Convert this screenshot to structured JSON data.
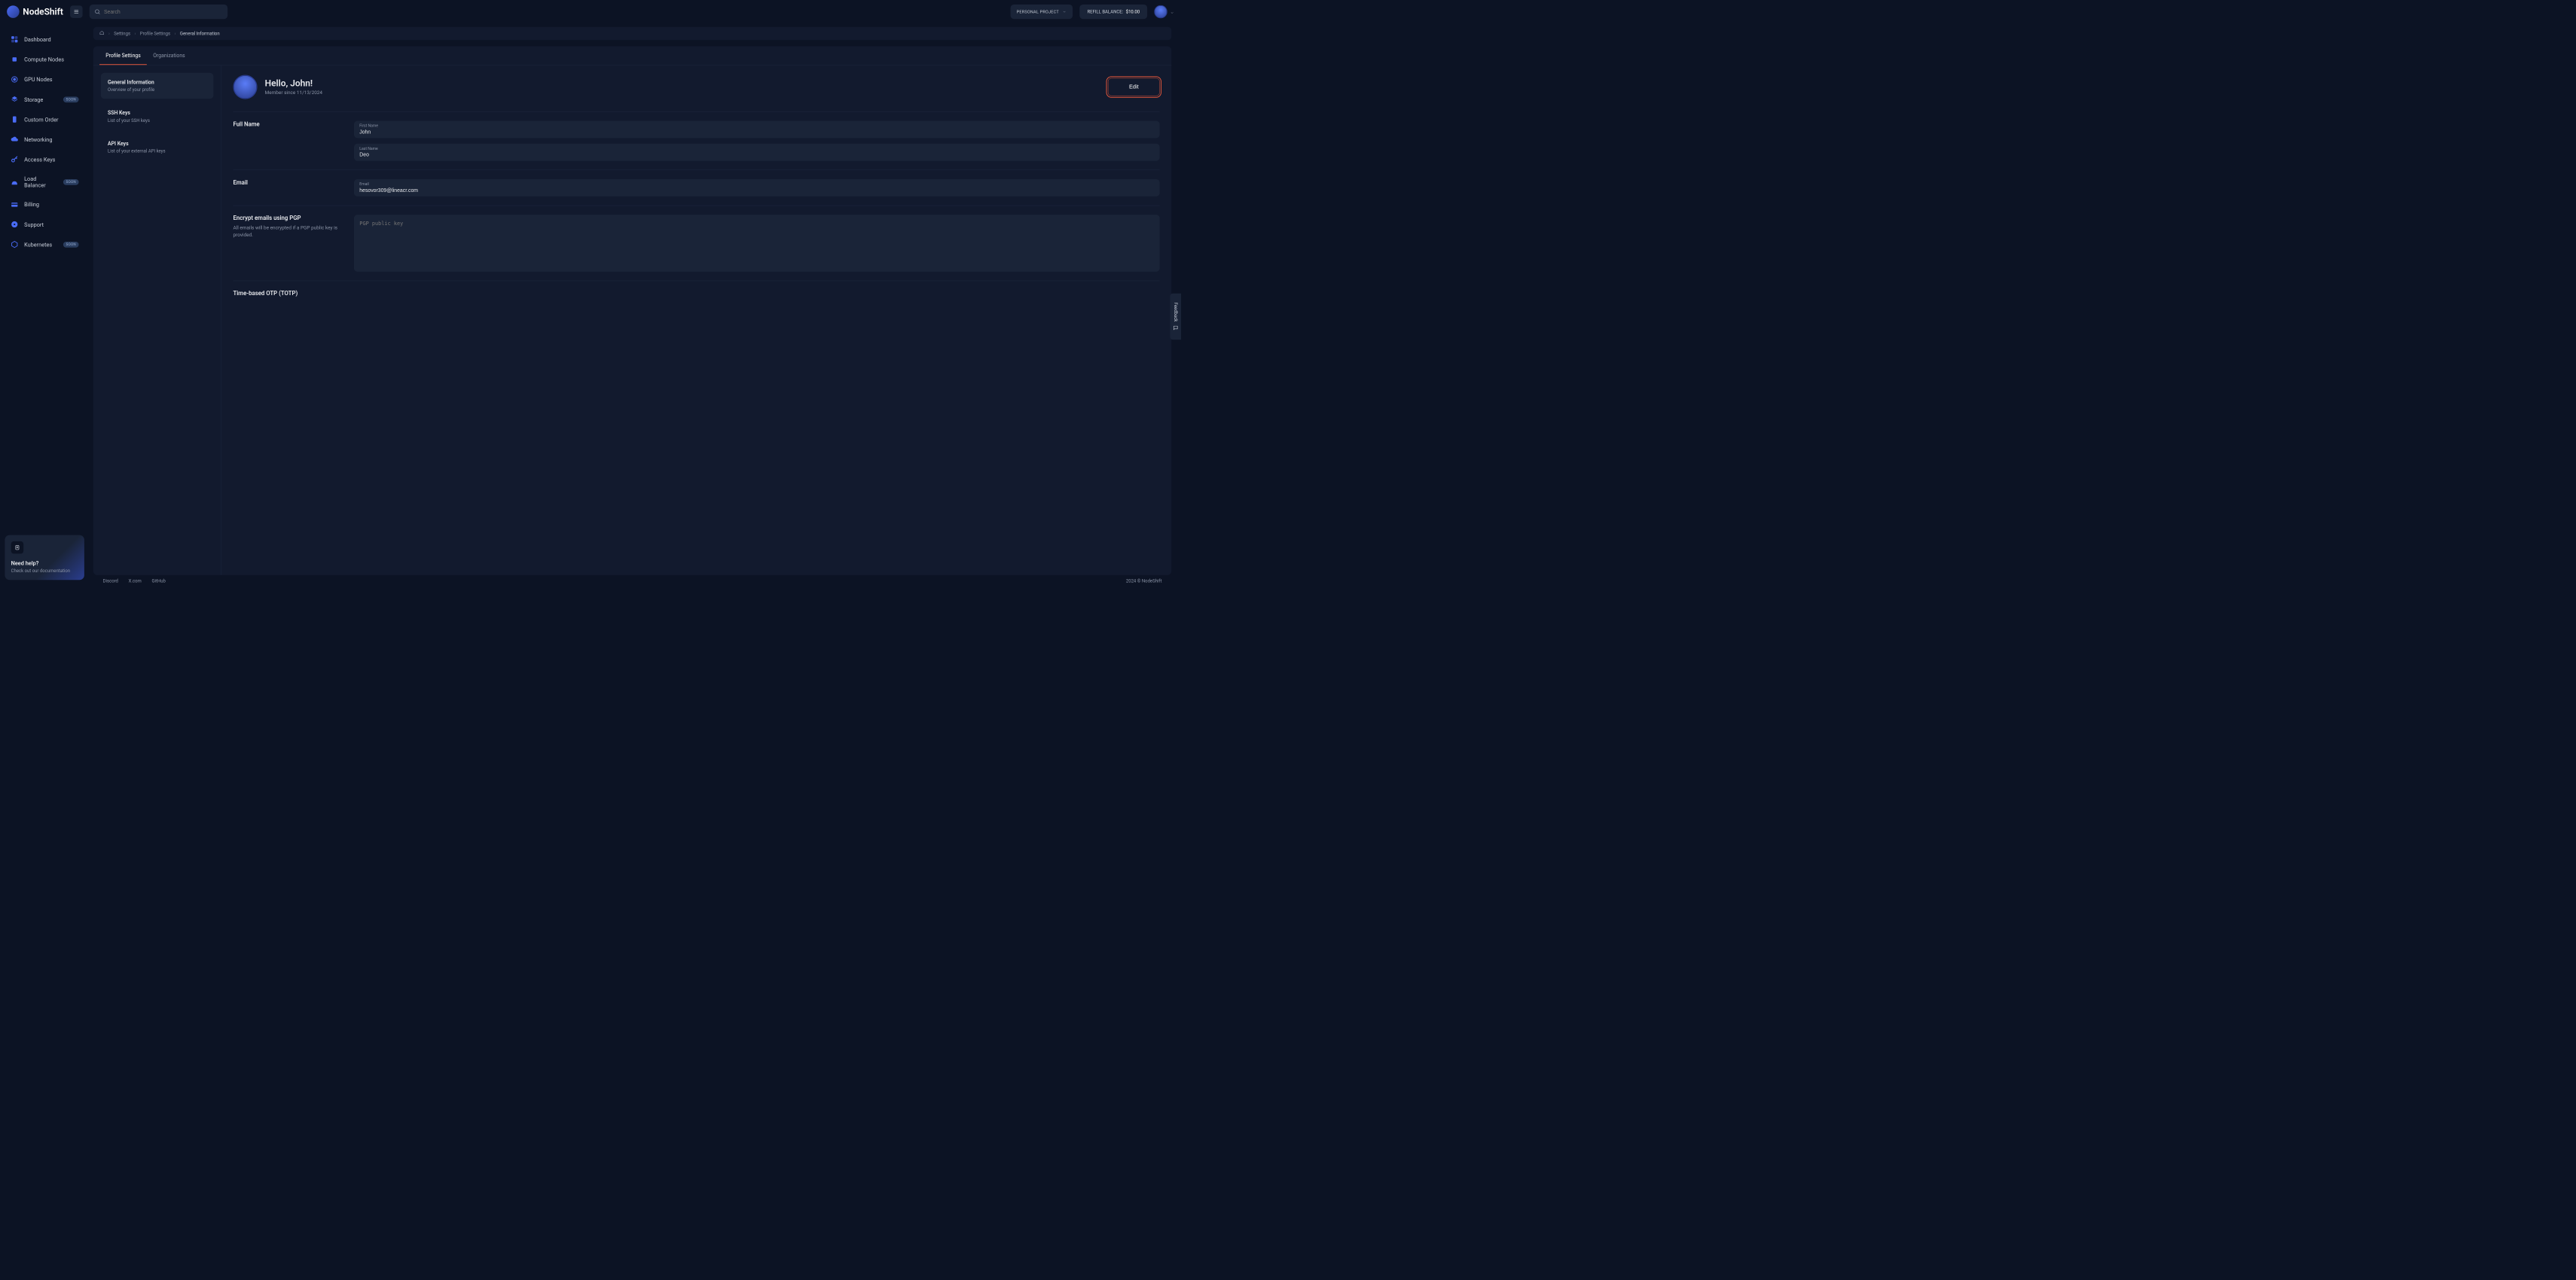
{
  "brand": "NodeShift",
  "search": {
    "placeholder": "Search"
  },
  "topbar": {
    "project_label": "PERSONAL PROJECT",
    "refill_label": "REFILL BALANCE:",
    "refill_amount": "$10.00"
  },
  "sidebar": {
    "items": [
      {
        "label": "Dashboard",
        "soon": false,
        "icon": "dashboard-icon"
      },
      {
        "label": "Compute Nodes",
        "soon": false,
        "icon": "cpu-icon"
      },
      {
        "label": "GPU Nodes",
        "soon": false,
        "icon": "gpu-icon"
      },
      {
        "label": "Storage",
        "soon": true,
        "icon": "storage-icon"
      },
      {
        "label": "Custom Order",
        "soon": false,
        "icon": "order-icon"
      },
      {
        "label": "Networking",
        "soon": false,
        "icon": "cloud-icon"
      },
      {
        "label": "Access Keys",
        "soon": false,
        "icon": "key-icon"
      },
      {
        "label": "Load Balancer",
        "soon": true,
        "icon": "balancer-icon"
      },
      {
        "label": "Billing",
        "soon": false,
        "icon": "billing-icon"
      },
      {
        "label": "Support",
        "soon": false,
        "icon": "support-icon"
      },
      {
        "label": "Kubernetes",
        "soon": true,
        "icon": "kubernetes-icon"
      }
    ],
    "soon_badge": "SOON"
  },
  "help": {
    "title": "Need help?",
    "sub": "Check out our documentation"
  },
  "breadcrumb": {
    "items": [
      "Settings",
      "Profile Settings",
      "General Information"
    ]
  },
  "tabs": [
    {
      "label": "Profile Settings",
      "active": true
    },
    {
      "label": "Organizations",
      "active": false
    }
  ],
  "subnav": [
    {
      "title": "General Information",
      "desc": "Overview of your profile",
      "active": true
    },
    {
      "title": "SSH Keys",
      "desc": "List of your SSH keys",
      "active": false
    },
    {
      "title": "API Keys",
      "desc": "List of your external API keys",
      "active": false
    }
  ],
  "profile": {
    "greeting": "Hello, John!",
    "member_since": "Member since 11/13/2024",
    "edit_label": "Edit"
  },
  "form": {
    "full_name_label": "Full Name",
    "first_name_label": "First Name",
    "first_name_value": "John",
    "last_name_label": "Last Name",
    "last_name_value": "Deo",
    "email_label": "Email",
    "email_field_label": "Email",
    "email_value": "hesovor309@lineacr.com",
    "pgp_title": "Encrypt emails using PGP",
    "pgp_desc": "All emails will be encrypted if a PGP public key is provided.",
    "pgp_placeholder": "PGP public key",
    "totp_title": "Time-based OTP (TOTP)"
  },
  "footer": {
    "links": [
      "Discord",
      "X.com",
      "GitHub"
    ],
    "copyright": "2024 © NodeShift"
  },
  "feedback": {
    "label": "Feedback"
  },
  "colors": {
    "accent": "#f05a3c",
    "bg": "#0c1324",
    "panel": "#121a2e",
    "surface": "#1a2438"
  }
}
